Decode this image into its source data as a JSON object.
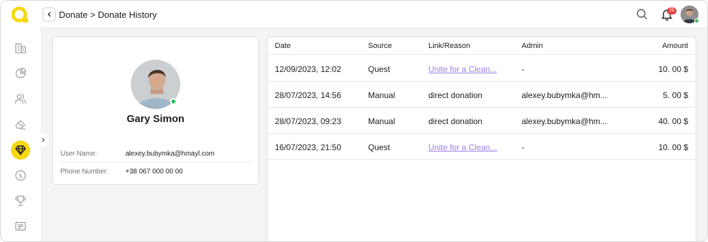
{
  "header": {
    "breadcrumb": "Donate > Donate History",
    "notification_count": "26"
  },
  "sidebar": {
    "items": [
      {
        "icon": "building-icon"
      },
      {
        "icon": "pie-chart-icon"
      },
      {
        "icon": "users-icon"
      },
      {
        "icon": "eraser-icon"
      },
      {
        "icon": "diamond-icon",
        "active": true
      },
      {
        "icon": "dollar-coin-icon"
      },
      {
        "icon": "trophy-icon"
      },
      {
        "icon": "newspaper-icon"
      }
    ]
  },
  "profile": {
    "name": "Gary Simon",
    "fields": [
      {
        "label": "User Name:",
        "value": "alexey.bubymka@hmayl.com"
      },
      {
        "label": "Phone Number:",
        "value": "+38 067 000 00 00"
      }
    ]
  },
  "table": {
    "headers": {
      "date": "Date",
      "source": "Source",
      "link": "Link/Reason",
      "admin": "Admin",
      "amount": "Amount"
    },
    "rows": [
      {
        "date": "12/09/2023, 12:02",
        "source": "Quest",
        "link": "Unite for a Clean...",
        "link_is_url": true,
        "admin": "-",
        "amount": "10. 00 $"
      },
      {
        "date": "28/07/2023, 14:56",
        "source": "Manual",
        "link": "direct donation",
        "link_is_url": false,
        "admin": "alexey.bubymka@hm...",
        "amount": "5. 00 $"
      },
      {
        "date": "28/07/2023, 09:23",
        "source": "Manual",
        "link": "direct donation",
        "link_is_url": false,
        "admin": "alexey.bubymka@hm...",
        "amount": "40. 00 $"
      },
      {
        "date": "16/07/2023, 21:50",
        "source": "Quest",
        "link": "Unite for a Clean...",
        "link_is_url": true,
        "admin": "-",
        "amount": "10. 00 $"
      }
    ]
  },
  "colors": {
    "accent": "#f5d80f",
    "online": "#2fbf5b",
    "link": "#9a7de3",
    "badge": "#e23b3b"
  }
}
